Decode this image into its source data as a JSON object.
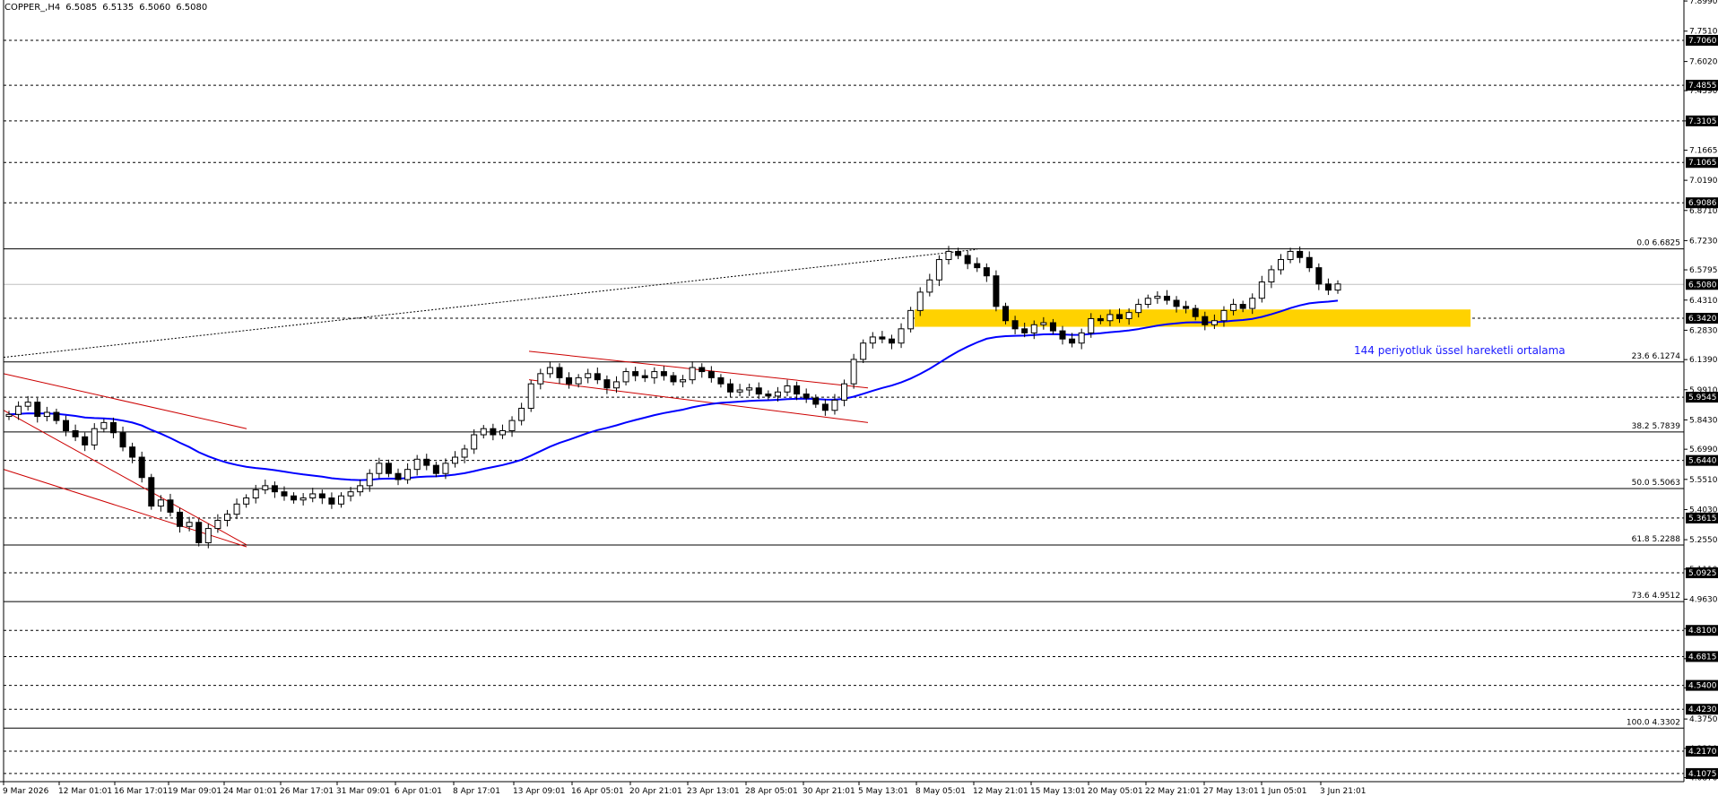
{
  "header": {
    "symbol": "COPPER_,H4",
    "open": "6.5085",
    "high": "6.5135",
    "low": "6.5060",
    "close": "6.5080"
  },
  "chart_data": {
    "type": "candlestick",
    "y_range": [
      4.03,
      7.92
    ],
    "price_ticks": [
      "7.8990",
      "7.7510",
      "7.6020",
      "7.4590",
      "7.3105",
      "7.1665",
      "7.0190",
      "6.8710",
      "6.7230",
      "6.5795",
      "6.4310",
      "6.2830",
      "6.1390",
      "5.9910",
      "5.8430",
      "5.6990",
      "5.5510",
      "5.4030",
      "5.2550",
      "5.1110",
      "4.9630",
      "4.8190",
      "4.6710",
      "4.5280",
      "4.3750",
      "4.2310",
      "4.0870"
    ],
    "level_badges": [
      "7.7060",
      "7.4855",
      "7.3105",
      "7.1065",
      "6.9086",
      "6.5080",
      "6.3420",
      "5.9545",
      "5.6440",
      "5.3615",
      "5.0925",
      "4.8100",
      "4.6815",
      "4.5400",
      "4.4230",
      "4.2170",
      "4.1075"
    ],
    "current_price": "6.5080",
    "fibonacci": [
      {
        "label": "0.0 6.6825",
        "price": 6.6825
      },
      {
        "label": "23.6 6.1274",
        "price": 6.1274
      },
      {
        "label": "38.2 5.7839",
        "price": 5.7839
      },
      {
        "label": "50.0 5.5063",
        "price": 5.5063
      },
      {
        "label": "61.8 5.2288",
        "price": 5.2288
      },
      {
        "label": "73.6 4.9512",
        "price": 4.9512
      },
      {
        "label": "100.0 4.3302",
        "price": 4.3302
      }
    ],
    "x_labels": [
      "9 Mar 2026",
      "12 Mar 01:01",
      "16 Mar 17:01",
      "19 Mar 09:01",
      "24 Mar 01:01",
      "26 Mar 17:01",
      "31 Mar 09:01",
      "6 Apr 01:01",
      "8 Apr 17:01",
      "13 Apr 09:01",
      "16 Apr 05:01",
      "20 Apr 21:01",
      "23 Apr 13:01",
      "28 Apr 05:01",
      "30 Apr 21:01",
      "5 May 13:01",
      "8 May 05:01",
      "12 May 21:01",
      "15 May 13:01",
      "20 May 05:01",
      "22 May 21:01",
      "27 May 13:01",
      "1 Jun 05:01",
      "3 Jun 21:01"
    ],
    "support_zone": {
      "low": 6.3,
      "high": 6.385
    },
    "ema_label": "144 periyotluk üssel hareketli ortalama",
    "ema_color": "#0000ff",
    "zone_color": "#ffd200",
    "channel_color": "#cc0000",
    "close_path": [
      5.87,
      5.91,
      5.93,
      5.86,
      5.88,
      5.84,
      5.79,
      5.76,
      5.72,
      5.8,
      5.83,
      5.78,
      5.71,
      5.66,
      5.56,
      5.42,
      5.45,
      5.39,
      5.32,
      5.34,
      5.24,
      5.31,
      5.35,
      5.38,
      5.43,
      5.46,
      5.5,
      5.52,
      5.49,
      5.47,
      5.45,
      5.46,
      5.48,
      5.46,
      5.43,
      5.47,
      5.49,
      5.52,
      5.58,
      5.63,
      5.58,
      5.55,
      5.6,
      5.65,
      5.62,
      5.58,
      5.63,
      5.66,
      5.7,
      5.77,
      5.8,
      5.77,
      5.79,
      5.84,
      5.9,
      6.02,
      6.07,
      6.1,
      6.05,
      6.02,
      6.05,
      6.07,
      6.04,
      6.0,
      6.03,
      6.08,
      6.06,
      6.05,
      6.08,
      6.06,
      6.03,
      6.04,
      6.1,
      6.08,
      6.05,
      6.02,
      5.98,
      5.99,
      6.0,
      5.97,
      5.96,
      5.98,
      6.01,
      5.97,
      5.95,
      5.92,
      5.89,
      5.94,
      6.02,
      6.14,
      6.22,
      6.25,
      6.24,
      6.22,
      6.29,
      6.38,
      6.47,
      6.53,
      6.63,
      6.67,
      6.65,
      6.61,
      6.59,
      6.55,
      6.4,
      6.33,
      6.29,
      6.27,
      6.31,
      6.32,
      6.28,
      6.24,
      6.22,
      6.27,
      6.34,
      6.33,
      6.36,
      6.34,
      6.37,
      6.41,
      6.44,
      6.45,
      6.43,
      6.4,
      6.39,
      6.35,
      6.31,
      6.33,
      6.38,
      6.41,
      6.39,
      6.44,
      6.52,
      6.58,
      6.63,
      6.67,
      6.64,
      6.59,
      6.51,
      6.48,
      6.51
    ]
  }
}
